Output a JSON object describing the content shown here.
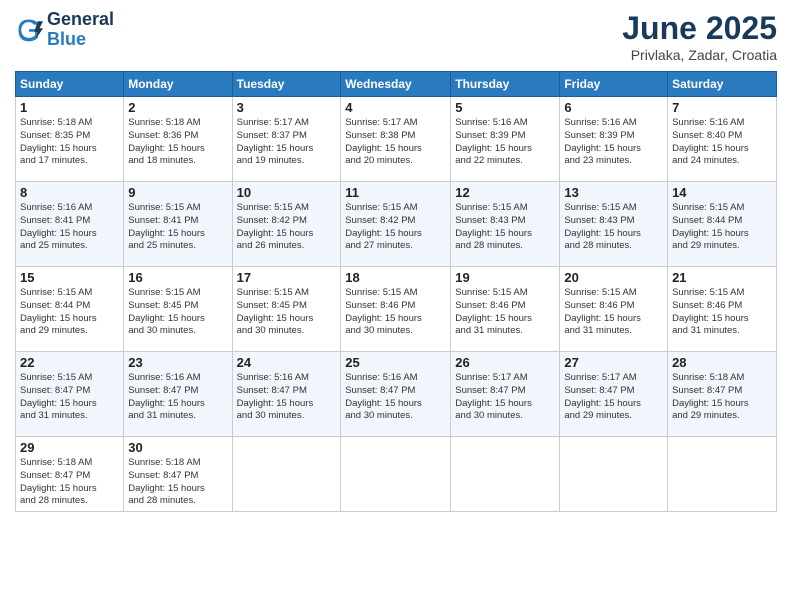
{
  "header": {
    "logo_line1": "General",
    "logo_line2": "Blue",
    "title": "June 2025",
    "location": "Privlaka, Zadar, Croatia"
  },
  "days_of_week": [
    "Sunday",
    "Monday",
    "Tuesday",
    "Wednesday",
    "Thursday",
    "Friday",
    "Saturday"
  ],
  "weeks": [
    [
      {
        "day": "1",
        "sunrise": "5:18 AM",
        "sunset": "8:35 PM",
        "daylight": "15 hours and 17 minutes."
      },
      {
        "day": "2",
        "sunrise": "5:18 AM",
        "sunset": "8:36 PM",
        "daylight": "15 hours and 18 minutes."
      },
      {
        "day": "3",
        "sunrise": "5:17 AM",
        "sunset": "8:37 PM",
        "daylight": "15 hours and 19 minutes."
      },
      {
        "day": "4",
        "sunrise": "5:17 AM",
        "sunset": "8:38 PM",
        "daylight": "15 hours and 20 minutes."
      },
      {
        "day": "5",
        "sunrise": "5:16 AM",
        "sunset": "8:39 PM",
        "daylight": "15 hours and 22 minutes."
      },
      {
        "day": "6",
        "sunrise": "5:16 AM",
        "sunset": "8:39 PM",
        "daylight": "15 hours and 23 minutes."
      },
      {
        "day": "7",
        "sunrise": "5:16 AM",
        "sunset": "8:40 PM",
        "daylight": "15 hours and 24 minutes."
      }
    ],
    [
      {
        "day": "8",
        "sunrise": "5:16 AM",
        "sunset": "8:41 PM",
        "daylight": "15 hours and 25 minutes."
      },
      {
        "day": "9",
        "sunrise": "5:15 AM",
        "sunset": "8:41 PM",
        "daylight": "15 hours and 25 minutes."
      },
      {
        "day": "10",
        "sunrise": "5:15 AM",
        "sunset": "8:42 PM",
        "daylight": "15 hours and 26 minutes."
      },
      {
        "day": "11",
        "sunrise": "5:15 AM",
        "sunset": "8:42 PM",
        "daylight": "15 hours and 27 minutes."
      },
      {
        "day": "12",
        "sunrise": "5:15 AM",
        "sunset": "8:43 PM",
        "daylight": "15 hours and 28 minutes."
      },
      {
        "day": "13",
        "sunrise": "5:15 AM",
        "sunset": "8:43 PM",
        "daylight": "15 hours and 28 minutes."
      },
      {
        "day": "14",
        "sunrise": "5:15 AM",
        "sunset": "8:44 PM",
        "daylight": "15 hours and 29 minutes."
      }
    ],
    [
      {
        "day": "15",
        "sunrise": "5:15 AM",
        "sunset": "8:44 PM",
        "daylight": "15 hours and 29 minutes."
      },
      {
        "day": "16",
        "sunrise": "5:15 AM",
        "sunset": "8:45 PM",
        "daylight": "15 hours and 30 minutes."
      },
      {
        "day": "17",
        "sunrise": "5:15 AM",
        "sunset": "8:45 PM",
        "daylight": "15 hours and 30 minutes."
      },
      {
        "day": "18",
        "sunrise": "5:15 AM",
        "sunset": "8:46 PM",
        "daylight": "15 hours and 30 minutes."
      },
      {
        "day": "19",
        "sunrise": "5:15 AM",
        "sunset": "8:46 PM",
        "daylight": "15 hours and 31 minutes."
      },
      {
        "day": "20",
        "sunrise": "5:15 AM",
        "sunset": "8:46 PM",
        "daylight": "15 hours and 31 minutes."
      },
      {
        "day": "21",
        "sunrise": "5:15 AM",
        "sunset": "8:46 PM",
        "daylight": "15 hours and 31 minutes."
      }
    ],
    [
      {
        "day": "22",
        "sunrise": "5:15 AM",
        "sunset": "8:47 PM",
        "daylight": "15 hours and 31 minutes."
      },
      {
        "day": "23",
        "sunrise": "5:16 AM",
        "sunset": "8:47 PM",
        "daylight": "15 hours and 31 minutes."
      },
      {
        "day": "24",
        "sunrise": "5:16 AM",
        "sunset": "8:47 PM",
        "daylight": "15 hours and 30 minutes."
      },
      {
        "day": "25",
        "sunrise": "5:16 AM",
        "sunset": "8:47 PM",
        "daylight": "15 hours and 30 minutes."
      },
      {
        "day": "26",
        "sunrise": "5:17 AM",
        "sunset": "8:47 PM",
        "daylight": "15 hours and 30 minutes."
      },
      {
        "day": "27",
        "sunrise": "5:17 AM",
        "sunset": "8:47 PM",
        "daylight": "15 hours and 29 minutes."
      },
      {
        "day": "28",
        "sunrise": "5:18 AM",
        "sunset": "8:47 PM",
        "daylight": "15 hours and 29 minutes."
      }
    ],
    [
      {
        "day": "29",
        "sunrise": "5:18 AM",
        "sunset": "8:47 PM",
        "daylight": "15 hours and 28 minutes."
      },
      {
        "day": "30",
        "sunrise": "5:18 AM",
        "sunset": "8:47 PM",
        "daylight": "15 hours and 28 minutes."
      },
      null,
      null,
      null,
      null,
      null
    ]
  ]
}
